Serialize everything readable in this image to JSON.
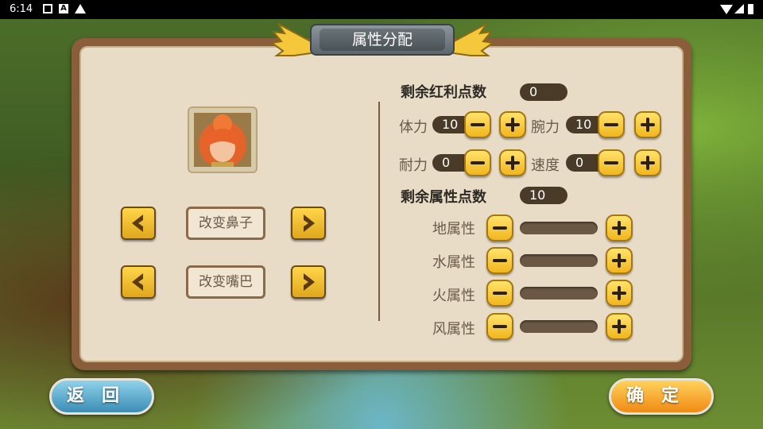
{
  "status_bar": {
    "time": "6:14"
  },
  "dialog": {
    "title": "属性分配",
    "bonus_label": "剩余红利点数",
    "bonus_value": "0",
    "stats": [
      {
        "label": "体力",
        "value": "10"
      },
      {
        "label": "腕力",
        "value": "10"
      },
      {
        "label": "耐力",
        "value": "0"
      },
      {
        "label": "速度",
        "value": "0"
      }
    ],
    "attr_points_label": "剩余属性点数",
    "attr_points_value": "10",
    "elements": [
      {
        "label": "地属性",
        "level": 0
      },
      {
        "label": "水属性",
        "level": 0
      },
      {
        "label": "火属性",
        "level": 0
      },
      {
        "label": "风属性",
        "level": 0
      }
    ],
    "change_nose_label": "改变鼻子",
    "change_mouth_label": "改变嘴巴"
  },
  "buttons": {
    "back": "返回",
    "confirm": "确定"
  },
  "icons": {
    "left_arrow": "chevron-left-icon",
    "right_arrow": "chevron-right-icon",
    "minus": "minus-icon",
    "plus": "plus-icon"
  },
  "colors": {
    "button_yellow": "#f0b61e",
    "panel_bg": "#e8dcc7",
    "back_blue": "#3c8db6",
    "confirm_orange": "#f08a14"
  }
}
